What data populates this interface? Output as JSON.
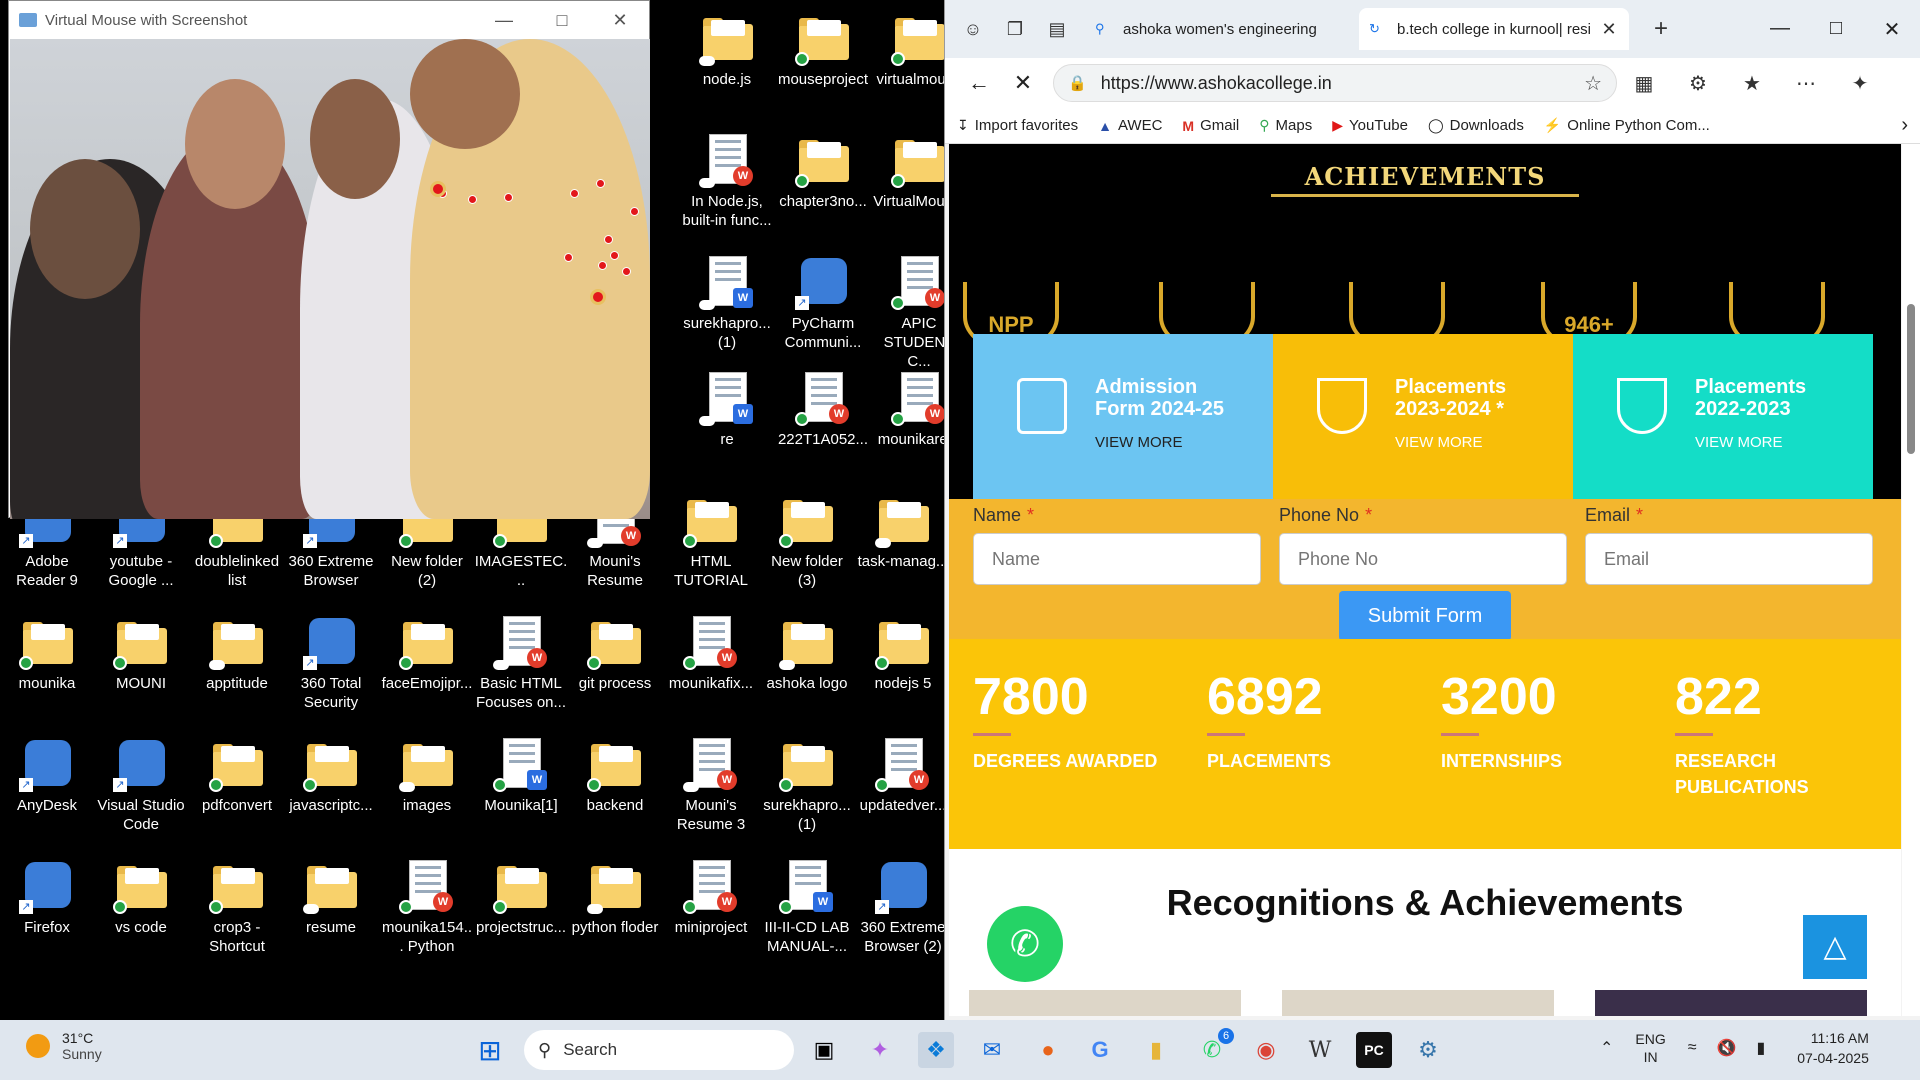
{
  "camera_window": {
    "title": "Virtual Mouse with Screenshot"
  },
  "desktop_icons": [
    {
      "label": "node.js",
      "type": "folder"
    },
    {
      "label": "mouseproject",
      "type": "folder"
    },
    {
      "label": "virtualmouse",
      "type": "folder"
    },
    {
      "label": "In Node.js, built-in func...",
      "type": "doc"
    },
    {
      "label": "chapter3no...",
      "type": "folder"
    },
    {
      "label": "VirtualMous...",
      "type": "folder"
    },
    {
      "label": "surekhapro... (1)",
      "type": "word"
    },
    {
      "label": "PyCharm Communi...",
      "type": "app"
    },
    {
      "label": "APIC STUDENT C...",
      "type": "doc"
    },
    {
      "label": "re",
      "type": "word"
    },
    {
      "label": "222T1A052...",
      "type": "doc"
    },
    {
      "label": "mounikare...",
      "type": "doc"
    },
    {
      "label": "Adobe Reader 9",
      "type": "app"
    },
    {
      "label": "youtube - Google ...",
      "type": "app"
    },
    {
      "label": "doublelinked list",
      "type": "folder"
    },
    {
      "label": "360 Extreme Browser",
      "type": "app"
    },
    {
      "label": "New folder (2)",
      "type": "folder"
    },
    {
      "label": "IMAGESTEC...",
      "type": "folder"
    },
    {
      "label": "Mouni's Resume",
      "type": "doc"
    },
    {
      "label": "HTML TUTORIAL",
      "type": "folder"
    },
    {
      "label": "New folder (3)",
      "type": "folder"
    },
    {
      "label": "task-manag...",
      "type": "folder"
    },
    {
      "label": "mounika",
      "type": "folder"
    },
    {
      "label": "MOUNI",
      "type": "folder"
    },
    {
      "label": "apptitude",
      "type": "folder"
    },
    {
      "label": "360 Total Security",
      "type": "app"
    },
    {
      "label": "faceEmojipr...",
      "type": "folder"
    },
    {
      "label": "Basic HTML Focuses on...",
      "type": "doc"
    },
    {
      "label": "git process",
      "type": "folder"
    },
    {
      "label": "mounikafix...",
      "type": "doc"
    },
    {
      "label": "ashoka logo",
      "type": "folder"
    },
    {
      "label": "nodejs 5",
      "type": "folder"
    },
    {
      "label": "AnyDesk",
      "type": "app"
    },
    {
      "label": "Visual Studio Code",
      "type": "app"
    },
    {
      "label": "pdfconvert",
      "type": "folder"
    },
    {
      "label": "javascriptc...",
      "type": "folder"
    },
    {
      "label": "images",
      "type": "folder"
    },
    {
      "label": "Mounika[1]",
      "type": "word"
    },
    {
      "label": "backend",
      "type": "folder"
    },
    {
      "label": "Mouni's Resume 3",
      "type": "doc"
    },
    {
      "label": "surekhapro... (1)",
      "type": "folder"
    },
    {
      "label": "updatedver...",
      "type": "doc"
    },
    {
      "label": "Firefox",
      "type": "app"
    },
    {
      "label": "vs code",
      "type": "folder"
    },
    {
      "label": "crop3 - Shortcut",
      "type": "folder"
    },
    {
      "label": "resume",
      "type": "folder"
    },
    {
      "label": "mounika154... Python",
      "type": "doc"
    },
    {
      "label": "projectstruc...",
      "type": "folder"
    },
    {
      "label": "python floder",
      "type": "folder"
    },
    {
      "label": "miniproject",
      "type": "doc"
    },
    {
      "label": "III-II-CD LAB MANUAL-...",
      "type": "word"
    },
    {
      "label": "360 Extreme Browser (2)",
      "type": "app"
    }
  ],
  "browser": {
    "tabs": [
      {
        "title": "ashoka women's engineering",
        "active": false
      },
      {
        "title": "b.tech college in kurnool| resi",
        "active": true
      }
    ],
    "url": "https://www.ashokacollege.in",
    "favorites": [
      {
        "label": "Import favorites",
        "icon": "import-icon"
      },
      {
        "label": "AWEC",
        "icon": "awec-icon"
      },
      {
        "label": "Gmail",
        "icon": "gmail-icon"
      },
      {
        "label": "Maps",
        "icon": "maps-icon"
      },
      {
        "label": "YouTube",
        "icon": "youtube-icon"
      },
      {
        "label": "Downloads",
        "icon": "globe-icon"
      },
      {
        "label": "Online Python Com...",
        "icon": "python-icon"
      }
    ]
  },
  "page": {
    "hero_title": "ACHIEVEMENTS",
    "laurel_labels": [
      "NPP",
      "946+"
    ],
    "cards": [
      {
        "title_line1": "Admission",
        "title_line2": "Form 2024-25",
        "more": "VIEW MORE",
        "color": "#6cc5f2"
      },
      {
        "title_line1": "Placements",
        "title_line2": "2023-2024 *",
        "more": "VIEW MORE",
        "color": "#f8be08"
      },
      {
        "title_line1": "Placements",
        "title_line2": "2022-2023",
        "more": "VIEW MORE",
        "color": "#14ddc7"
      }
    ],
    "form": {
      "name_label": "Name",
      "name_placeholder": "Name",
      "phone_label": "Phone No",
      "phone_placeholder": "Phone No",
      "email_label": "Email",
      "email_placeholder": "Email",
      "required_mark": "*",
      "submit": "Submit Form"
    },
    "stats": [
      {
        "value": "7800",
        "caption_line1": "DEGREES AWARDED",
        "caption_line2": ""
      },
      {
        "value": "6892",
        "caption_line1": "PLACEMENTS",
        "caption_line2": ""
      },
      {
        "value": "3200",
        "caption_line1": "INTERNSHIPS",
        "caption_line2": ""
      },
      {
        "value": "822",
        "caption_line1": "RESEARCH",
        "caption_line2": "PUBLICATIONS"
      }
    ],
    "recognitions_title": "Recognitions & Achievements"
  },
  "taskbar": {
    "weather_temp": "31°C",
    "weather_cond": "Sunny",
    "search_placeholder": "Search",
    "whatsapp_badge": "6",
    "lang_line1": "ENG",
    "lang_line2": "IN",
    "time": "11:16 AM",
    "date": "07-04-2025"
  },
  "colors": {
    "hero_bg": "#000000",
    "form_bg": "#f3b62e",
    "stats_bg": "#fbc508",
    "submit_bg": "#3b98f4",
    "whatsapp": "#25d366"
  }
}
